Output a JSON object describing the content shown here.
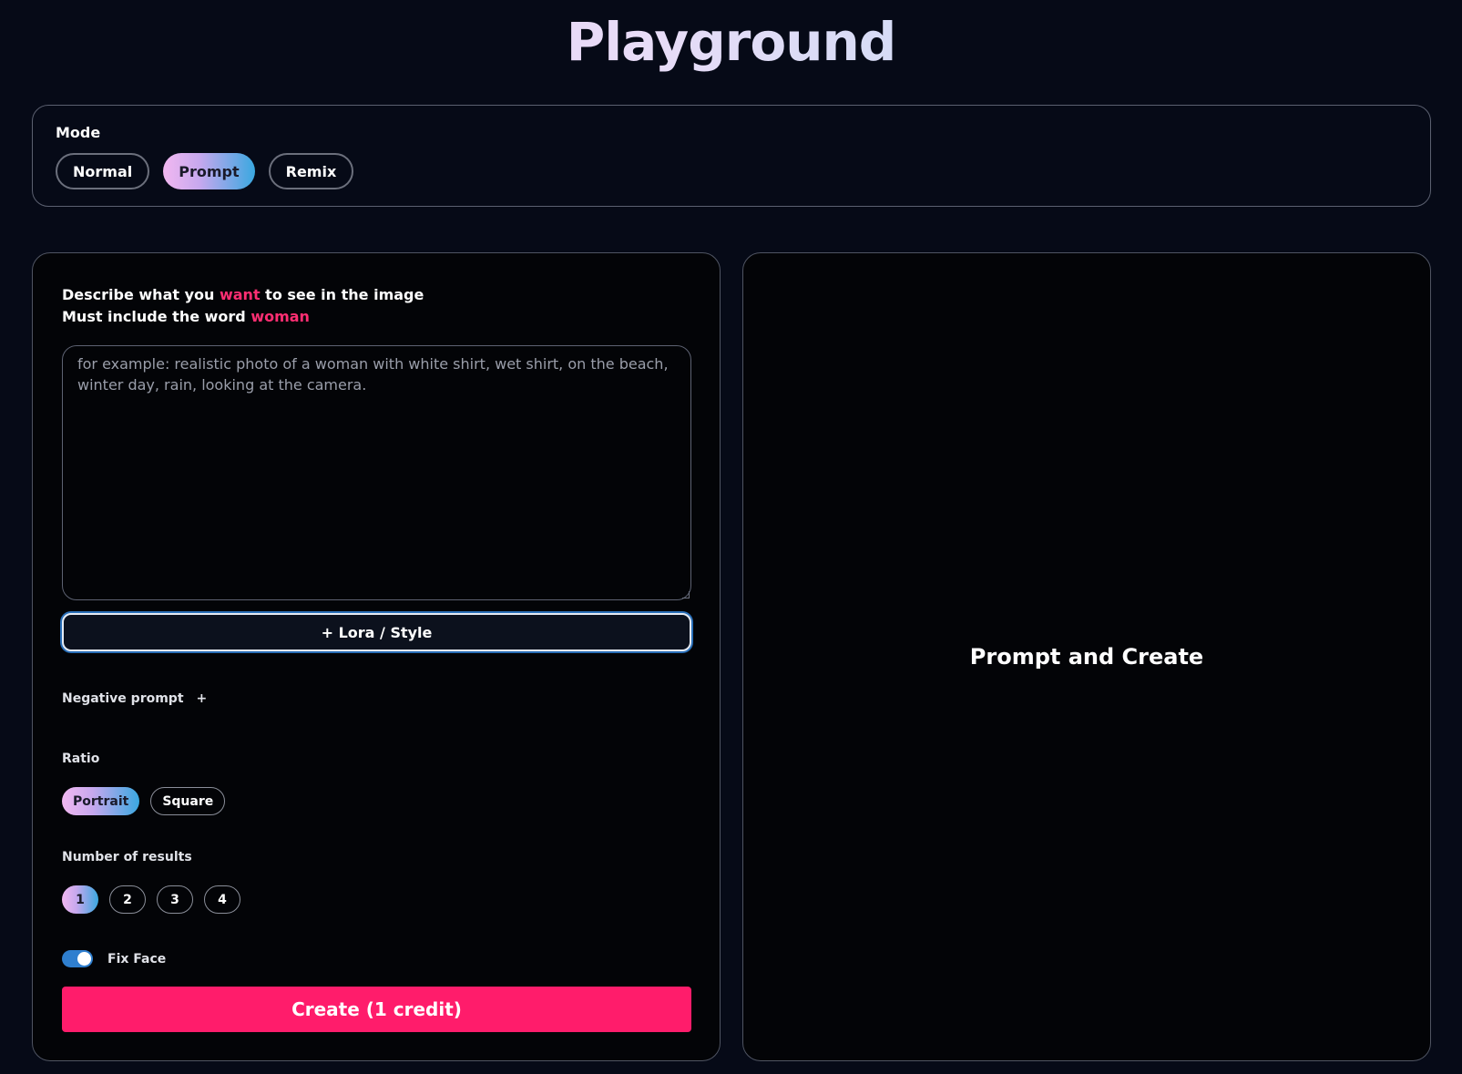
{
  "header": {
    "title": "Playground"
  },
  "mode": {
    "label": "Mode",
    "options": [
      {
        "label": "Normal",
        "active": false
      },
      {
        "label": "Prompt",
        "active": true
      },
      {
        "label": "Remix",
        "active": false
      }
    ]
  },
  "form": {
    "description_line1_pre": "Describe what you ",
    "description_line1_accent": "want",
    "description_line1_post": " to see in the image",
    "description_line2_pre": "Must include the word ",
    "description_line2_accent": "woman",
    "prompt_placeholder": "for example: realistic photo of a woman with white shirt, wet shirt, on the beach, winter day, rain, looking at the camera.",
    "prompt_value": "",
    "lora_button": "+ Lora / Style",
    "negative_prompt_label": "Negative prompt",
    "negative_prompt_toggle": "+",
    "ratio_label": "Ratio",
    "ratio_options": [
      {
        "label": "Portrait",
        "active": true
      },
      {
        "label": "Square",
        "active": false
      }
    ],
    "results_label": "Number of results",
    "results_options": [
      {
        "label": "1",
        "active": true
      },
      {
        "label": "2",
        "active": false
      },
      {
        "label": "3",
        "active": false
      },
      {
        "label": "4",
        "active": false
      }
    ],
    "fix_face_label": "Fix Face",
    "fix_face_enabled": true,
    "create_button": "Create (1 credit)"
  },
  "preview": {
    "title": "Prompt and Create"
  },
  "colors": {
    "accent": "#ff1c6b",
    "background": "#060a17",
    "toggle_on": "#2f7fcf"
  }
}
